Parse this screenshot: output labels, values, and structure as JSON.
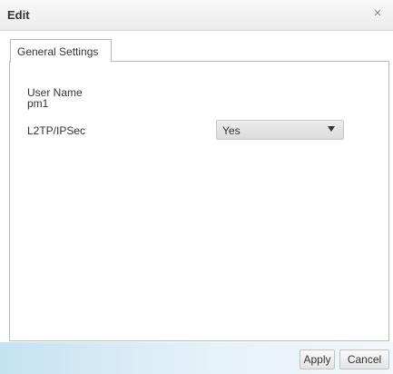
{
  "dialog": {
    "title": "Edit",
    "close_icon": "×"
  },
  "tabs": [
    {
      "label": "General Settings",
      "active": true
    }
  ],
  "form": {
    "user_name_label": "User Name",
    "user_name_value": "pm1",
    "l2tp_label": "L2TP/IPSec",
    "l2tp_selected": "Yes"
  },
  "footer": {
    "apply_label": "Apply",
    "cancel_label": "Cancel"
  },
  "colors": {
    "footer_gradient_start": "#c5e2f2",
    "footer_gradient_end": "#f1f7fb",
    "border": "#b9b9b9"
  }
}
